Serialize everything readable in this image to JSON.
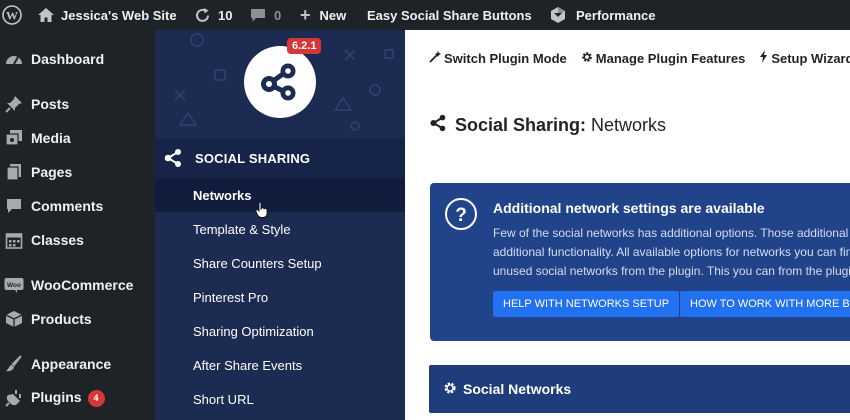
{
  "admin_bar": {
    "site_name": "Jessica's Web Site",
    "updates_count": "10",
    "comments_count": "0",
    "new_label": "New",
    "plugin_label": "Easy Social Share Buttons",
    "performance_label": "Performance"
  },
  "wp_menu": {
    "items": [
      {
        "label": "Dashboard",
        "icon": "dashboard-icon"
      },
      {
        "label": "Posts",
        "icon": "pin-icon"
      },
      {
        "label": "Media",
        "icon": "media-icon"
      },
      {
        "label": "Pages",
        "icon": "pages-icon"
      },
      {
        "label": "Comments",
        "icon": "comments-icon"
      },
      {
        "label": "Classes",
        "icon": "calendar-icon"
      },
      {
        "label": "WooCommerce",
        "icon": "woo-icon"
      },
      {
        "label": "Products",
        "icon": "box-icon"
      },
      {
        "label": "Appearance",
        "icon": "brush-icon"
      },
      {
        "label": "Plugins",
        "icon": "plug-icon",
        "badge": "4"
      }
    ]
  },
  "plugin_sidebar": {
    "version": "6.2.1",
    "section_title": "SOCIAL SHARING",
    "items": [
      {
        "label": "Networks",
        "active": true
      },
      {
        "label": "Template & Style"
      },
      {
        "label": "Share Counters Setup"
      },
      {
        "label": "Pinterest Pro"
      },
      {
        "label": "Sharing Optimization"
      },
      {
        "label": "After Share Events"
      },
      {
        "label": "Short URL"
      }
    ]
  },
  "toolbar": {
    "switch_mode": "Switch Plugin Mode",
    "manage_features": "Manage Plugin Features",
    "setup_wizard": "Setup Wizard"
  },
  "page": {
    "title_bold": "Social Sharing:",
    "title_rest": "Networks"
  },
  "notice": {
    "heading": "Additional network settings are available",
    "lines": [
      "Few of the social networks has additional options. Those additional options",
      "additional functionality. All available options for networks you can find",
      "unused social networks from the plugin. This you can from the plugin settings"
    ],
    "button_help": "HELP WITH NETWORKS SETUP",
    "button_how": "HOW TO WORK WITH MORE BUTTONS"
  },
  "panel": {
    "title": "Social Networks"
  },
  "colors": {
    "admin_bg": "#1d2327",
    "plugin_sidebar_bg": "#1c2b52",
    "notice_bg": "#21438a",
    "button_bg": "#2271f0",
    "badge_red": "#d63638"
  }
}
